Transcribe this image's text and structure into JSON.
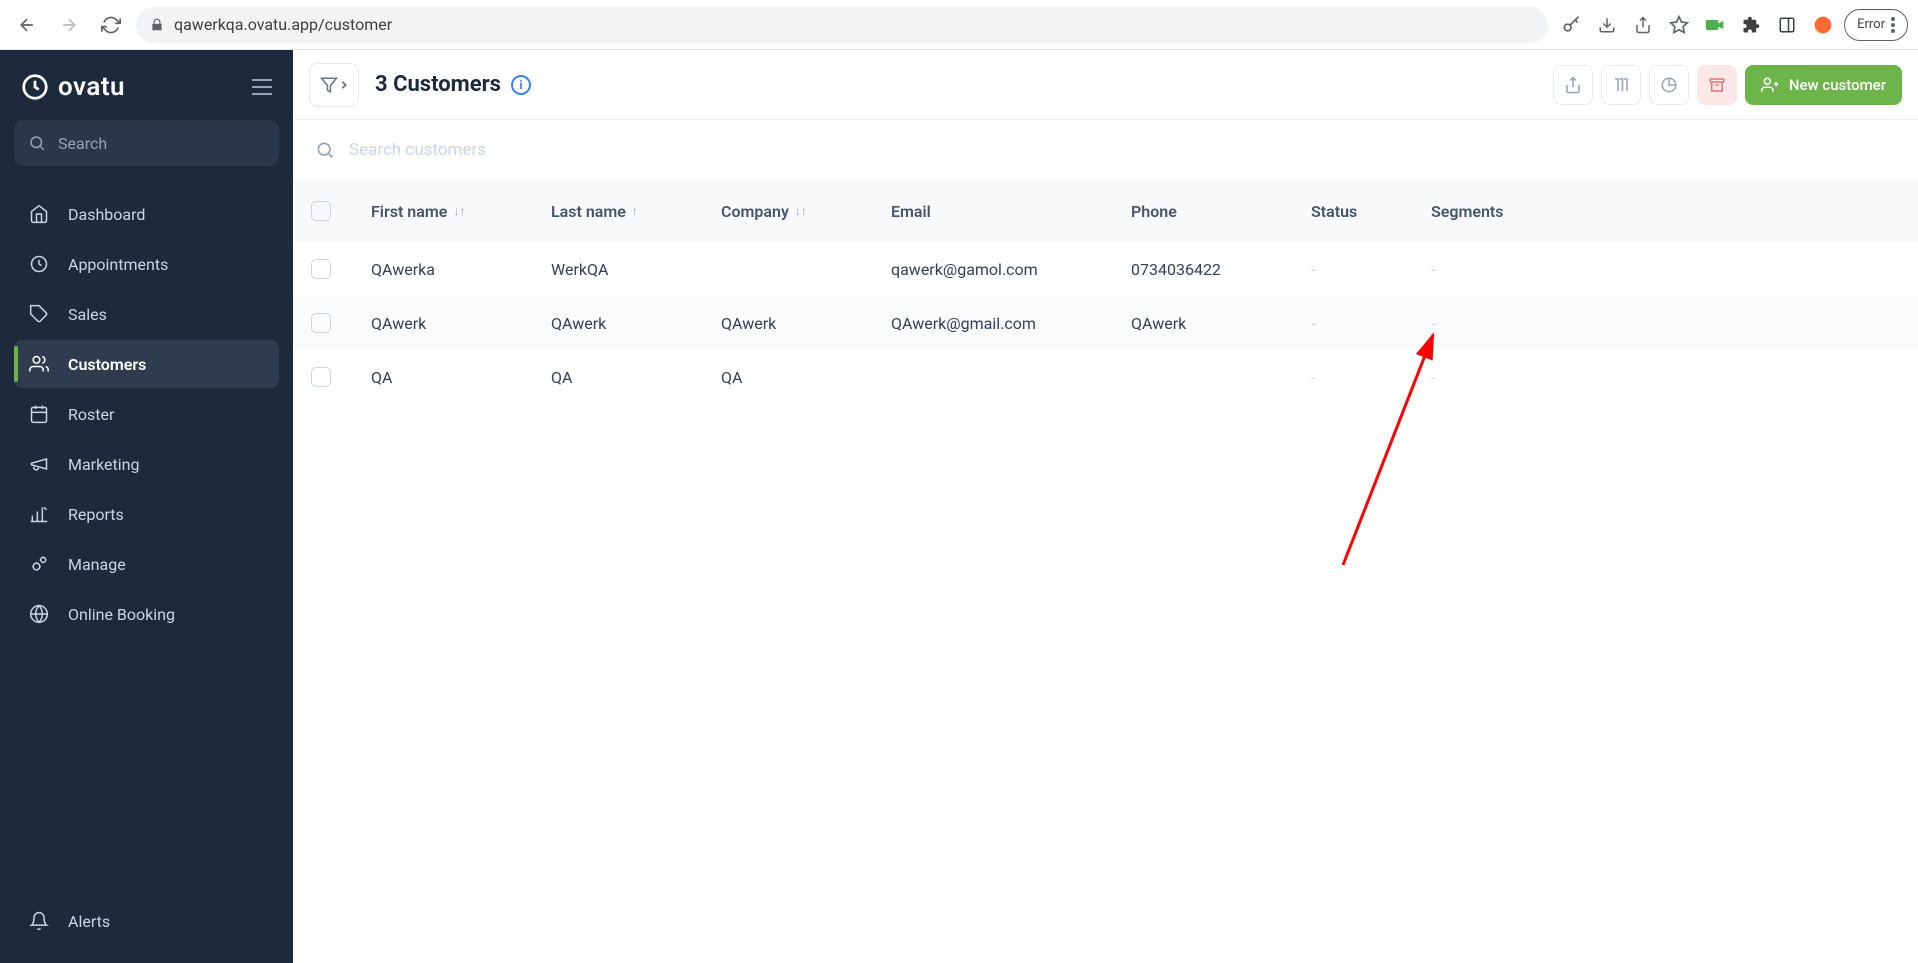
{
  "browser": {
    "url": "qawerkqa.ovatu.app/customer",
    "error_label": "Error"
  },
  "sidebar": {
    "brand": "ovatu",
    "search_label": "Search",
    "items": [
      {
        "label": "Dashboard"
      },
      {
        "label": "Appointments"
      },
      {
        "label": "Sales"
      },
      {
        "label": "Customers"
      },
      {
        "label": "Roster"
      },
      {
        "label": "Marketing"
      },
      {
        "label": "Reports"
      },
      {
        "label": "Manage"
      },
      {
        "label": "Online Booking"
      }
    ],
    "alerts_label": "Alerts"
  },
  "header": {
    "title": "3 Customers",
    "new_button": "New customer"
  },
  "search": {
    "placeholder": "Search customers"
  },
  "table": {
    "headers": {
      "first_name": "First name",
      "last_name": "Last name",
      "company": "Company",
      "email": "Email",
      "phone": "Phone",
      "status": "Status",
      "segments": "Segments"
    },
    "rows": [
      {
        "first_name": "QAwerka",
        "last_name": "WerkQA",
        "company": "",
        "email": "qawerk@gamol.com",
        "phone": "0734036422",
        "status": "-",
        "segments": "-"
      },
      {
        "first_name": "QAwerk",
        "last_name": "QAwerk",
        "company": "QAwerk",
        "email": "QAwerk@gmail.com",
        "phone": "QAwerk",
        "status": "-",
        "segments": "-"
      },
      {
        "first_name": "QA",
        "last_name": "QA",
        "company": "QA",
        "email": "",
        "phone": "",
        "status": "-",
        "segments": "-"
      }
    ]
  }
}
